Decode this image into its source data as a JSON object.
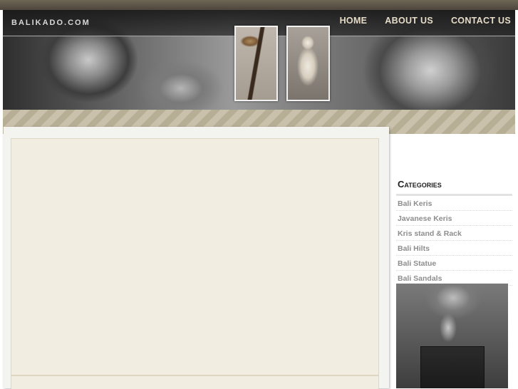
{
  "site": {
    "logo": "BALIKADO.COM"
  },
  "nav": {
    "items": [
      "HOME",
      "ABOUT US",
      "CONTACT US"
    ]
  },
  "sidebar": {
    "title": "Categories",
    "categories": [
      "Bali Keris",
      "Javanese Keris",
      "Kris stand & Rack",
      "Bali Hilts",
      "Bali Statue",
      "Bali Sandals"
    ]
  },
  "colors": {
    "nav_text": "#e6dcc8",
    "content_bg": "#f1ede0",
    "category_text": "#8d8d8d"
  }
}
